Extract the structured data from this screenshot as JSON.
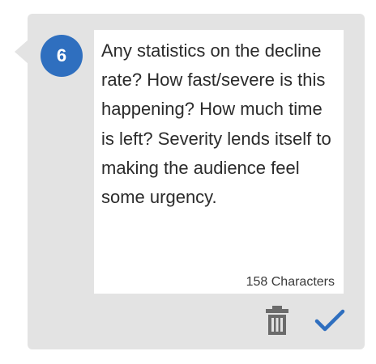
{
  "comment": {
    "number": "6",
    "text": "Any statistics on the decline rate? How fast/severe is this happening? How much time is left? Severity lends itself to making the audience feel some urgency.",
    "char_count": "158",
    "char_count_suffix": "Characters"
  },
  "actions": {
    "delete_icon": "trash-icon",
    "confirm_icon": "checkmark-icon"
  },
  "colors": {
    "card_bg": "#e3e3e3",
    "badge_bg": "#2f6fbf",
    "check_color": "#2f6fbf",
    "trash_color": "#6b6b6b"
  }
}
